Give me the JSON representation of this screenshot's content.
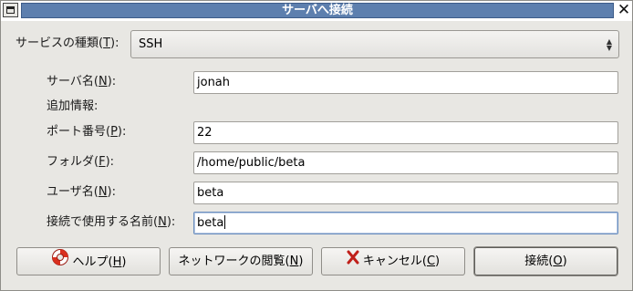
{
  "window": {
    "title": "サーバへ接続",
    "close_glyph": "✕"
  },
  "service_type": {
    "label_prefix": "サービスの種類(",
    "label_key": "T",
    "label_suffix": "):",
    "selected": "SSH",
    "arrows_icon": "up-down-chevron"
  },
  "fields": {
    "server": {
      "label_prefix": "サーバ名(",
      "key": "N",
      "label_suffix": "):",
      "value": "jonah"
    },
    "extra_info_heading": "追加情報:",
    "port": {
      "label_prefix": "ポート番号(",
      "key": "P",
      "label_suffix": "):",
      "value": "22"
    },
    "folder": {
      "label_prefix": "フォルダ(",
      "key": "F",
      "label_suffix": "):",
      "value": "/home/public/beta"
    },
    "user": {
      "label_prefix": "ユーザ名(",
      "key": "N",
      "label_suffix": "):",
      "value": "beta"
    },
    "connect_name": {
      "label_prefix": "接続で使用する名前(",
      "key": "N",
      "label_suffix": "):",
      "value": "beta"
    }
  },
  "buttons": {
    "help": {
      "prefix": "ヘルプ(",
      "key": "H",
      "suffix": ")",
      "icon": "lifebuoy-icon"
    },
    "browse": {
      "prefix": "ネットワークの閲覧(",
      "key": "N",
      "suffix": ")"
    },
    "cancel": {
      "prefix": "キャンセル(",
      "key": "C",
      "suffix": ")",
      "icon": "red-x-icon"
    },
    "connect": {
      "prefix": "接続(",
      "key": "O",
      "suffix": ")"
    }
  },
  "colors": {
    "title_bar": "#5d7fae",
    "window_bg": "#e8e7e3",
    "focus_border": "#6c8fbf"
  }
}
